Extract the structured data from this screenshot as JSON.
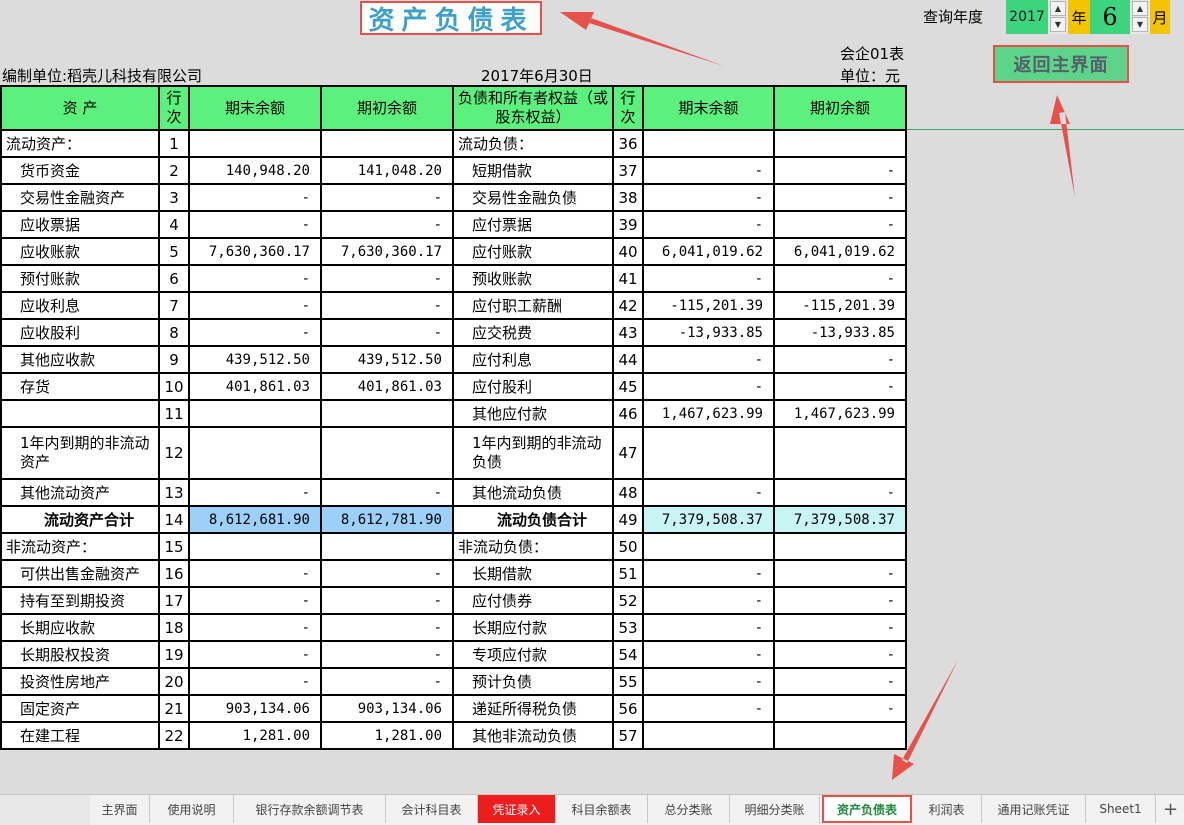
{
  "title": "资产负债表",
  "form_code": "会企01表",
  "company": "编制单位:稻壳儿科技有限公司",
  "date": "2017年6月30日",
  "unit": "单位：元",
  "query": {
    "label": "查询年度",
    "year": "2017",
    "year_unit": "年",
    "month": "6",
    "month_unit": "月"
  },
  "return_button": "返回主界面",
  "headers": {
    "asset": "资 产",
    "line": "行次",
    "end": "期末余额",
    "begin": "期初余额",
    "liab": "负债和所有者权益（或股东权益）"
  },
  "rows": [
    {
      "a_name": "流动资产：",
      "a_no": "1",
      "a_end": "",
      "a_begin": "",
      "l_name": "流动负债：",
      "l_no": "36",
      "l_end": "",
      "l_begin": ""
    },
    {
      "a_name": "货币资金",
      "a_no": "2",
      "a_end": "140,948.20",
      "a_begin": "141,048.20",
      "l_name": "短期借款",
      "l_no": "37",
      "l_end": "-",
      "l_begin": "-"
    },
    {
      "a_name": "交易性金融资产",
      "a_no": "3",
      "a_end": "-",
      "a_begin": "-",
      "l_name": "交易性金融负债",
      "l_no": "38",
      "l_end": "-",
      "l_begin": "-"
    },
    {
      "a_name": "应收票据",
      "a_no": "4",
      "a_end": "-",
      "a_begin": "-",
      "l_name": "应付票据",
      "l_no": "39",
      "l_end": "-",
      "l_begin": "-"
    },
    {
      "a_name": "应收账款",
      "a_no": "5",
      "a_end": "7,630,360.17",
      "a_begin": "7,630,360.17",
      "l_name": "应付账款",
      "l_no": "40",
      "l_end": "6,041,019.62",
      "l_begin": "6,041,019.62"
    },
    {
      "a_name": "预付账款",
      "a_no": "6",
      "a_end": "-",
      "a_begin": "-",
      "l_name": "预收账款",
      "l_no": "41",
      "l_end": "-",
      "l_begin": "-"
    },
    {
      "a_name": "应收利息",
      "a_no": "7",
      "a_end": "-",
      "a_begin": "-",
      "l_name": "应付职工薪酬",
      "l_no": "42",
      "l_end": "-115,201.39",
      "l_begin": "-115,201.39"
    },
    {
      "a_name": "应收股利",
      "a_no": "8",
      "a_end": "-",
      "a_begin": "-",
      "l_name": "应交税费",
      "l_no": "43",
      "l_end": "-13,933.85",
      "l_begin": "-13,933.85"
    },
    {
      "a_name": "其他应收款",
      "a_no": "9",
      "a_end": "439,512.50",
      "a_begin": "439,512.50",
      "l_name": "应付利息",
      "l_no": "44",
      "l_end": "-",
      "l_begin": "-"
    },
    {
      "a_name": "存货",
      "a_no": "10",
      "a_end": "401,861.03",
      "a_begin": "401,861.03",
      "l_name": "应付股利",
      "l_no": "45",
      "l_end": "-",
      "l_begin": "-"
    },
    {
      "a_name": "",
      "a_no": "11",
      "a_end": "",
      "a_begin": "",
      "l_name": "其他应付款",
      "l_no": "46",
      "l_end": "1,467,623.99",
      "l_begin": "1,467,623.99"
    },
    {
      "a_name": "1年内到期的非流动资产",
      "a_no": "12",
      "a_end": "",
      "a_begin": "",
      "l_name": "1年内到期的非流动负债",
      "l_no": "47",
      "l_end": "",
      "l_begin": ""
    },
    {
      "a_name": "其他流动资产",
      "a_no": "13",
      "a_end": "-",
      "a_begin": "-",
      "l_name": "其他流动负债",
      "l_no": "48",
      "l_end": "-",
      "l_begin": "-"
    },
    {
      "a_name": "流动资产合计",
      "a_no": "14",
      "a_end": "8,612,681.90",
      "a_begin": "8,612,781.90",
      "l_name": "流动负债合计",
      "l_no": "49",
      "l_end": "7,379,508.37",
      "l_begin": "7,379,508.37"
    },
    {
      "a_name": "非流动资产：",
      "a_no": "15",
      "a_end": "",
      "a_begin": "",
      "l_name": "非流动负债：",
      "l_no": "50",
      "l_end": "",
      "l_begin": ""
    },
    {
      "a_name": "可供出售金融资产",
      "a_no": "16",
      "a_end": "-",
      "a_begin": "-",
      "l_name": "长期借款",
      "l_no": "51",
      "l_end": "-",
      "l_begin": "-"
    },
    {
      "a_name": "持有至到期投资",
      "a_no": "17",
      "a_end": "-",
      "a_begin": "-",
      "l_name": "应付债券",
      "l_no": "52",
      "l_end": "-",
      "l_begin": "-"
    },
    {
      "a_name": "长期应收款",
      "a_no": "18",
      "a_end": "-",
      "a_begin": "-",
      "l_name": "长期应付款",
      "l_no": "53",
      "l_end": "-",
      "l_begin": "-"
    },
    {
      "a_name": "长期股权投资",
      "a_no": "19",
      "a_end": "-",
      "a_begin": "-",
      "l_name": "专项应付款",
      "l_no": "54",
      "l_end": "-",
      "l_begin": "-"
    },
    {
      "a_name": "投资性房地产",
      "a_no": "20",
      "a_end": "-",
      "a_begin": "-",
      "l_name": "预计负债",
      "l_no": "55",
      "l_end": "-",
      "l_begin": "-"
    },
    {
      "a_name": "固定资产",
      "a_no": "21",
      "a_end": "903,134.06",
      "a_begin": "903,134.06",
      "l_name": "递延所得税负债",
      "l_no": "56",
      "l_end": "-",
      "l_begin": "-"
    },
    {
      "a_name": "在建工程",
      "a_no": "22",
      "a_end": "1,281.00",
      "a_begin": "1,281.00",
      "l_name": "其他非流动负债",
      "l_no": "57",
      "l_end": "",
      "l_begin": ""
    }
  ],
  "tabs": [
    "主界面",
    "使用说明",
    "银行存款余额调节表",
    "会计科目表",
    "凭证录入",
    "科目余额表",
    "总分类账",
    "明细分类账",
    "资产负债表",
    "利润表",
    "通用记账凭证",
    "Sheet1"
  ],
  "colors": {
    "header_green": "#5cf07c",
    "title_blue": "#3ea0c8",
    "highlight_red": "#e8504a",
    "selection_blue": "#9cd0f8"
  }
}
